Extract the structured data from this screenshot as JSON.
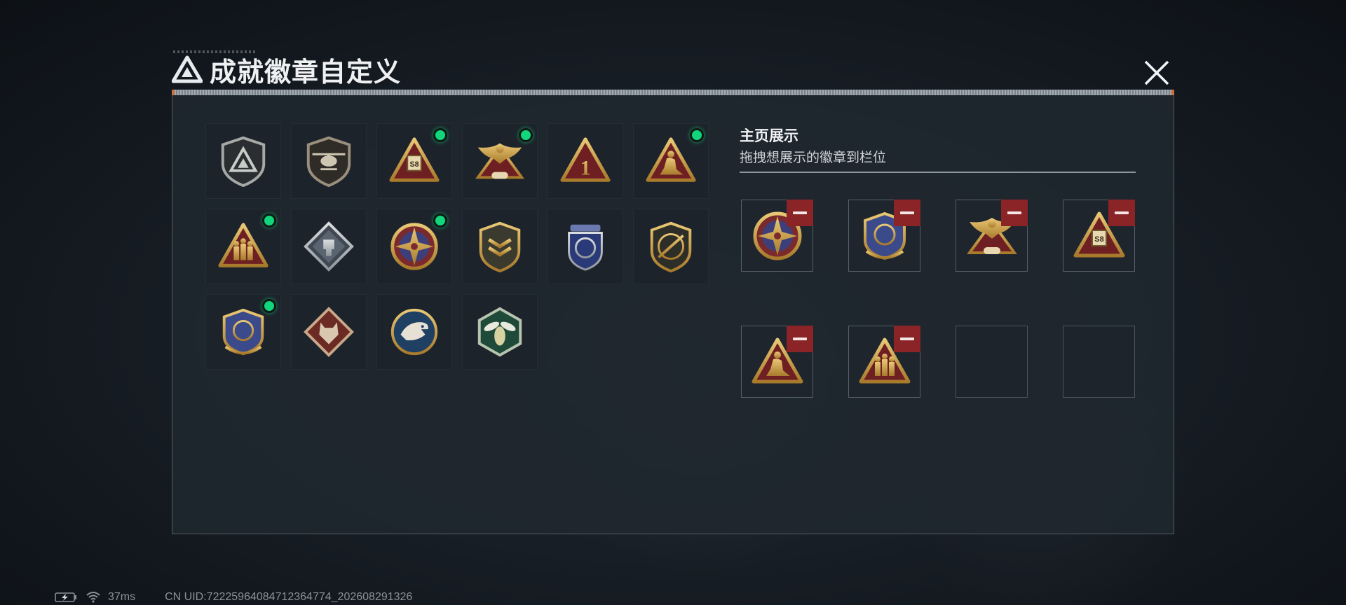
{
  "header": {
    "title": "成就徽章自定义",
    "logo_icon": "triangle-logo-icon",
    "close_icon": "close-icon"
  },
  "badges": [
    {
      "name": "triangle-shield-badge",
      "has_new": false
    },
    {
      "name": "helicopter-shield-badge",
      "has_new": false
    },
    {
      "name": "s8-triangle-badge",
      "has_new": true
    },
    {
      "name": "phoenix-badge",
      "has_new": true
    },
    {
      "name": "number-one-triangle-badge",
      "has_new": false
    },
    {
      "name": "seated-figure-triangle-badge",
      "has_new": true
    },
    {
      "name": "soldiers-triangle-badge",
      "has_new": true
    },
    {
      "name": "fist-diamond-badge",
      "has_new": false
    },
    {
      "name": "star-compass-badge",
      "has_new": true
    },
    {
      "name": "chevron-shield-badge",
      "has_new": false
    },
    {
      "name": "blue-laurel-badge",
      "has_new": false
    },
    {
      "name": "rifle-shield-badge",
      "has_new": false
    },
    {
      "name": "crosshair-shield-badge",
      "has_new": true
    },
    {
      "name": "wolf-diamond-badge",
      "has_new": false
    },
    {
      "name": "eagle-circle-badge",
      "has_new": false
    },
    {
      "name": "hornet-hexagon-badge",
      "has_new": false
    }
  ],
  "showcase": {
    "title": "主页展示",
    "subtitle": "拖拽想展示的徽章到栏位",
    "slots": [
      {
        "badge": "star-compass-badge"
      },
      {
        "badge": "crosshair-shield-badge"
      },
      {
        "badge": "phoenix-badge"
      },
      {
        "badge": "s8-triangle-badge"
      },
      {
        "badge": "seated-figure-triangle-badge"
      },
      {
        "badge": "soldiers-triangle-badge"
      },
      {
        "badge": null
      },
      {
        "badge": null
      }
    ]
  },
  "status_bar": {
    "battery_icon": "battery-charging-icon",
    "wifi_icon": "wifi-icon",
    "ping": "37ms",
    "uid": "CN UID:72225964084712364774_202608291326"
  },
  "colors": {
    "gold": "#c9a24e",
    "new_dot": "#12d67c",
    "remove": "#8b2427"
  }
}
